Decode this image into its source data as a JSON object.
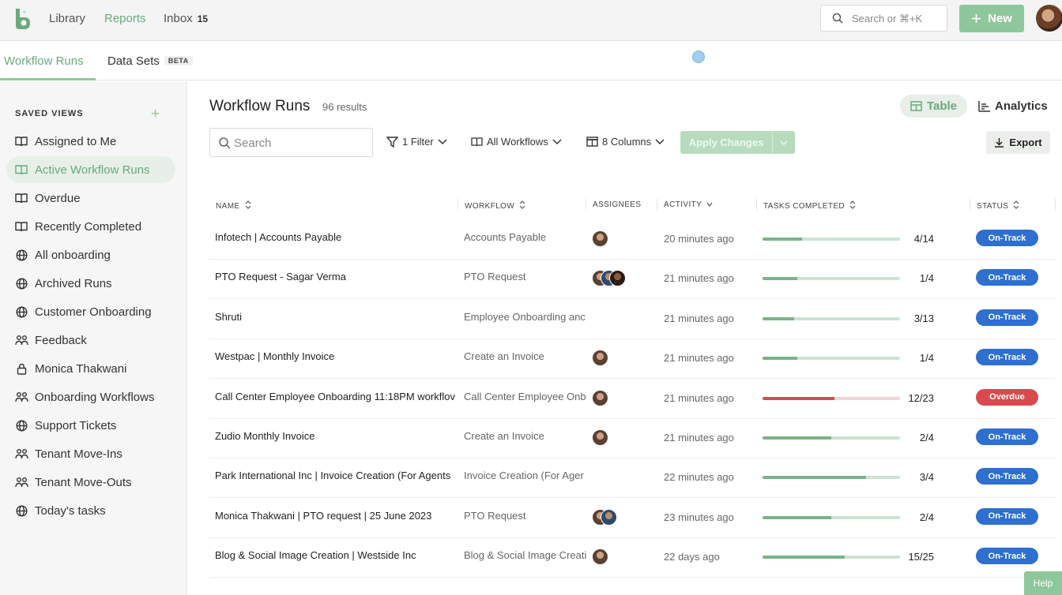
{
  "topnav": {
    "links": [
      "Library",
      "Reports",
      "Inbox"
    ],
    "inbox_count": "15",
    "search_placeholder": "Search or ⌘+K",
    "new_label": "New"
  },
  "tabs": {
    "workflow_runs": "Workflow Runs",
    "data_sets": "Data Sets",
    "beta": "BETA"
  },
  "sidebar": {
    "title": "SAVED VIEWS",
    "items": [
      {
        "label": "Assigned to Me",
        "icon": "book-icon"
      },
      {
        "label": "Active Workflow Runs",
        "icon": "book-icon"
      },
      {
        "label": "Overdue",
        "icon": "book-icon"
      },
      {
        "label": "Recently Completed",
        "icon": "book-icon"
      },
      {
        "label": "All onboarding",
        "icon": "globe-icon"
      },
      {
        "label": "Archived Runs",
        "icon": "globe-icon"
      },
      {
        "label": "Customer Onboarding",
        "icon": "globe-icon"
      },
      {
        "label": "Feedback",
        "icon": "users-icon"
      },
      {
        "label": "Monica Thakwani",
        "icon": "lock-icon"
      },
      {
        "label": "Onboarding Workflows",
        "icon": "users-icon"
      },
      {
        "label": "Support Tickets",
        "icon": "globe-icon"
      },
      {
        "label": "Tenant Move-Ins",
        "icon": "users-icon"
      },
      {
        "label": "Tenant Move-Outs",
        "icon": "users-icon"
      },
      {
        "label": "Today's tasks",
        "icon": "globe-icon"
      }
    ]
  },
  "main": {
    "title": "Workflow Runs",
    "results": "96 results",
    "view_table": "Table",
    "view_analytics": "Analytics",
    "search_placeholder": "Search",
    "filter_label": "1 Filter",
    "workflows_label": "All Workflows",
    "columns_label": "8 Columns",
    "apply_label": "Apply Changes",
    "export_label": "Export"
  },
  "table": {
    "headers": [
      "NAME",
      "WORKFLOW",
      "ASSIGNEES",
      "ACTIVITY",
      "TASKS COMPLETED",
      "STATUS"
    ],
    "rows": [
      {
        "name": "Infotech | Accounts Payable",
        "workflow": "Accounts Payable",
        "assignees": 1,
        "activity": "20 minutes ago",
        "done": 4,
        "total": 14,
        "count": "4/14",
        "status": "On-Track"
      },
      {
        "name": "PTO Request - Sagar Verma",
        "workflow": "PTO Request",
        "assignees": 3,
        "activity": "21 minutes ago",
        "done": 1,
        "total": 4,
        "count": "1/4",
        "status": "On-Track"
      },
      {
        "name": "Shruti",
        "workflow": "Employee Onboarding anc",
        "assignees": 0,
        "activity": "21 minutes ago",
        "done": 3,
        "total": 13,
        "count": "3/13",
        "status": "On-Track"
      },
      {
        "name": "Westpac | Monthly Invoice",
        "workflow": "Create an Invoice",
        "assignees": 1,
        "activity": "21 minutes ago",
        "done": 1,
        "total": 4,
        "count": "1/4",
        "status": "On-Track"
      },
      {
        "name": "Call Center Employee Onboarding 11:18PM workflov",
        "workflow": "Call Center Employee Onb",
        "assignees": 1,
        "activity": "21 minutes ago",
        "done": 12,
        "total": 23,
        "count": "12/23",
        "status": "Overdue"
      },
      {
        "name": "Zudio Monthly Invoice",
        "workflow": "Create an Invoice",
        "assignees": 1,
        "activity": "21 minutes ago",
        "done": 2,
        "total": 4,
        "count": "2/4",
        "status": "On-Track"
      },
      {
        "name": "Park International Inc | Invoice Creation (For Agents",
        "workflow": "Invoice Creation (For Ager",
        "assignees": 0,
        "activity": "22 minutes ago",
        "done": 3,
        "total": 4,
        "count": "3/4",
        "status": "On-Track"
      },
      {
        "name": "Monica Thakwani | PTO request | 25 June 2023",
        "workflow": "PTO Request",
        "assignees": 2,
        "activity": "23 minutes ago",
        "done": 2,
        "total": 4,
        "count": "2/4",
        "status": "On-Track"
      },
      {
        "name": "Blog & Social Image Creation | Westside Inc",
        "workflow": "Blog & Social Image Creati",
        "assignees": 1,
        "activity": "22 days ago",
        "done": 15,
        "total": 25,
        "count": "15/25",
        "status": "On-Track"
      }
    ]
  },
  "help_label": "Help",
  "colors": {
    "accent": "#6aaa7c",
    "on_track": "#2e6fd0",
    "overdue": "#d84a4e"
  }
}
